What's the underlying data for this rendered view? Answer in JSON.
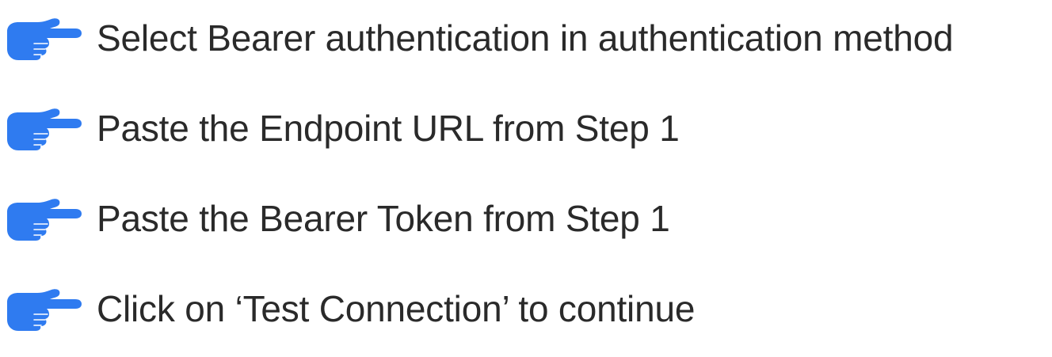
{
  "accent_color": "#2f7bf0",
  "text_color": "#2a2a2a",
  "steps": [
    {
      "icon": "pointing-hand-icon",
      "text": "Select Bearer authentication in authentication method"
    },
    {
      "icon": "pointing-hand-icon",
      "text": "Paste the Endpoint URL from Step 1"
    },
    {
      "icon": "pointing-hand-icon",
      "text": "Paste the Bearer Token from Step 1"
    },
    {
      "icon": "pointing-hand-icon",
      "text": "Click on ‘Test Connection’ to continue"
    }
  ]
}
